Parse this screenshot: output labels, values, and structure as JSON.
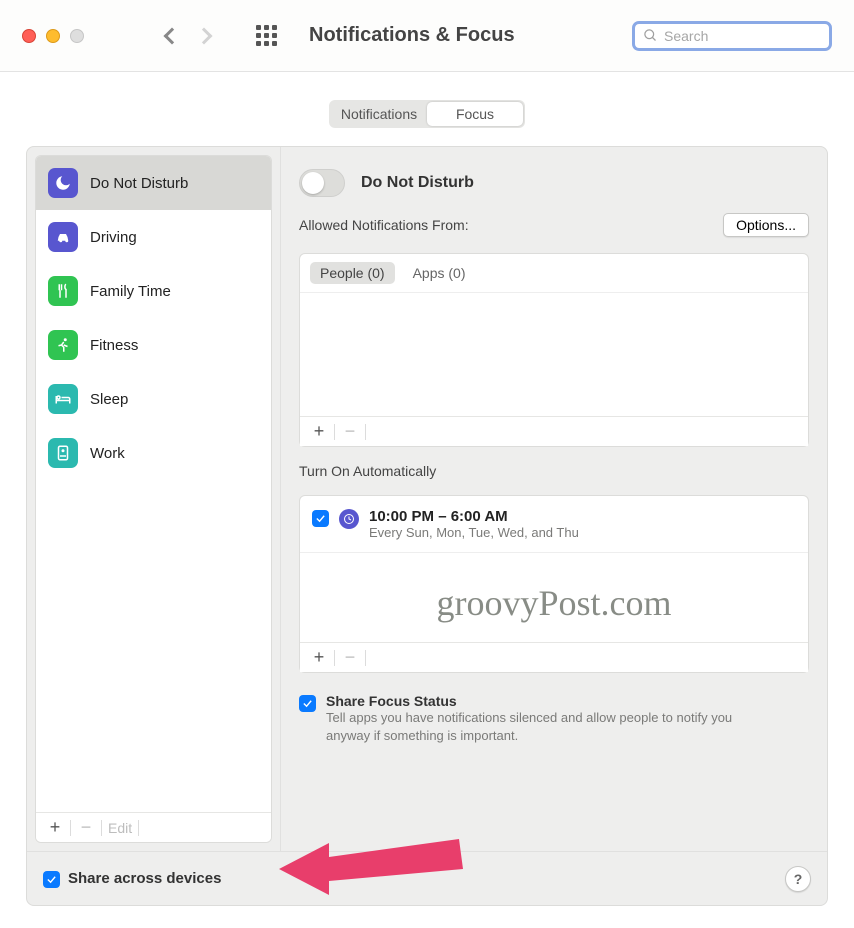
{
  "toolbar": {
    "title": "Notifications & Focus",
    "search_placeholder": "Search"
  },
  "tabs": {
    "notifications": "Notifications",
    "focus": "Focus"
  },
  "focus_modes": [
    {
      "label": "Do Not Disturb"
    },
    {
      "label": "Driving"
    },
    {
      "label": "Family Time"
    },
    {
      "label": "Fitness"
    },
    {
      "label": "Sleep"
    },
    {
      "label": "Work"
    }
  ],
  "list_footer": {
    "edit": "Edit"
  },
  "detail": {
    "heading": "Do Not Disturb",
    "allowed_label": "Allowed Notifications From:",
    "options_btn": "Options...",
    "allowed_tabs": {
      "people": "People (0)",
      "apps": "Apps (0)"
    },
    "auto_label": "Turn On Automatically",
    "schedule": {
      "time": "10:00 PM – 6:00 AM",
      "days": "Every Sun, Mon, Tue, Wed, and Thu"
    },
    "share_status": {
      "title": "Share Focus Status",
      "desc": "Tell apps you have notifications silenced and allow people to notify you anyway if something is important."
    },
    "watermark": "groovyPost.com"
  },
  "bottom": {
    "share_devices": "Share across devices",
    "help": "?"
  }
}
